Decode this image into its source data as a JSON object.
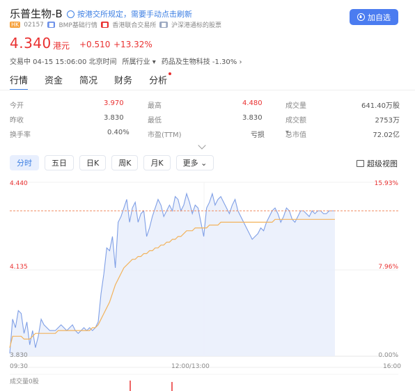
{
  "header": {
    "title": "乐普生物-B",
    "notice": "按港交所规定，需要手动点击刷新",
    "market_tag": "HK",
    "code": "02157",
    "bmp_tag": "BMP基础行情",
    "exchange": "香港联合交易所",
    "connect": "沪深港通标的股票",
    "add_button": "加自选"
  },
  "quote": {
    "price": "4.340",
    "unit": "港元",
    "change": "+0.510",
    "change_pct": "+13.32%",
    "status": "交易中 04-15 15:06:00 北京时间",
    "industry_label": "所属行业",
    "industry": "药品及生物科技 -1.30%"
  },
  "tabs": [
    "行情",
    "资金",
    "简况",
    "财务",
    "分析"
  ],
  "stats": [
    {
      "label": "今开",
      "value": "3.970",
      "color": "#e93030",
      "label2": "最高",
      "value2": "4.480",
      "color2": "#e93030",
      "label3": "成交量",
      "value3": "641.40万股"
    },
    {
      "label": "昨收",
      "value": "3.830",
      "color": "#555",
      "label2": "最低",
      "value2": "3.830",
      "color2": "#555",
      "label3": "成交额",
      "value3": "2753万"
    },
    {
      "label": "换手率",
      "value": "0.40%",
      "color": "#555",
      "label2": "市盈(TTM)",
      "value2": "亏损",
      "color2": "#555",
      "label3": "总市值",
      "value3": "72.02亿"
    }
  ],
  "periods": [
    "分时",
    "五日",
    "日K",
    "周K",
    "月K",
    "更多"
  ],
  "super_view": "超级视图",
  "volume_label": "成交量0股",
  "chart_data": {
    "type": "line",
    "ylim": [
      3.83,
      4.44
    ],
    "yticks_left": [
      "4.440",
      "4.135",
      "3.830"
    ],
    "yticks_right": [
      "15.93%",
      "7.96%",
      "0.00%"
    ],
    "xticks": [
      "09:30",
      "12:00/13:00",
      "16:00"
    ],
    "prev_close": 3.83,
    "reference_line": 4.34,
    "series": [
      {
        "values": [
          3.84,
          3.96,
          3.93,
          3.99,
          3.98,
          3.91,
          3.95,
          3.87,
          3.92,
          3.86,
          3.9,
          3.96,
          3.94,
          3.93,
          3.92,
          3.92,
          3.92,
          3.93,
          3.94,
          3.93,
          3.92,
          3.93,
          3.94,
          3.92,
          3.91,
          3.92,
          3.93,
          3.92,
          3.93,
          3.92,
          3.93,
          3.95,
          4.05,
          4.12,
          4.21,
          4.2,
          4.25,
          4.14,
          4.3,
          4.32,
          4.35,
          4.38,
          4.3,
          4.35,
          4.37,
          4.3,
          4.33,
          4.34,
          4.25,
          4.28,
          4.32,
          4.35,
          4.38,
          4.36,
          4.32,
          4.34,
          4.36,
          4.34,
          4.39,
          4.38,
          4.34,
          4.36,
          4.4,
          4.37,
          4.33,
          4.36,
          4.35,
          4.3,
          4.25,
          4.35,
          4.37,
          4.4,
          4.36,
          4.38,
          4.39,
          4.37,
          4.35,
          4.33,
          4.36,
          4.38,
          4.34,
          4.32,
          4.3,
          4.28,
          4.26,
          4.24,
          4.25,
          4.26,
          4.28,
          4.27,
          4.3,
          4.32,
          4.34,
          4.35,
          4.33,
          4.3,
          4.32,
          4.35,
          4.34,
          4.31,
          4.3,
          4.32,
          4.34,
          4.34,
          4.33,
          4.32,
          4.34,
          4.33,
          4.34,
          4.34,
          4.33,
          4.33,
          4.34,
          4.34,
          4.34
        ]
      },
      {
        "values": [
          3.86,
          3.9,
          3.9,
          3.9,
          3.9,
          3.89,
          3.89,
          3.89,
          3.9,
          3.91,
          3.91,
          3.91,
          3.91,
          3.91,
          3.91,
          3.91,
          3.91,
          3.92,
          3.92,
          3.92,
          3.92,
          3.92,
          3.92,
          3.92,
          3.92,
          3.92,
          3.92,
          3.92,
          3.92,
          3.93,
          3.93,
          3.94,
          3.96,
          3.98,
          4.0,
          4.02,
          4.05,
          4.08,
          4.1,
          4.12,
          4.14,
          4.15,
          4.16,
          4.17,
          4.17,
          4.18,
          4.18,
          4.19,
          4.19,
          4.2,
          4.2,
          4.21,
          4.21,
          4.22,
          4.22,
          4.23,
          4.23,
          4.24,
          4.24,
          4.25,
          4.25,
          4.26,
          4.27,
          4.27,
          4.27,
          4.28,
          4.28,
          4.28,
          4.28,
          4.28,
          4.29,
          4.29,
          4.29,
          4.29,
          4.3,
          4.3,
          4.3,
          4.3,
          4.3,
          4.3,
          4.3,
          4.3,
          4.3,
          4.3,
          4.3,
          4.3,
          4.3,
          4.3,
          4.3,
          4.3,
          4.3,
          4.3,
          4.3,
          4.31,
          4.31,
          4.31,
          4.31,
          4.31,
          4.31,
          4.31,
          4.31,
          4.31,
          4.31,
          4.31,
          4.31,
          4.31,
          4.31,
          4.31,
          4.31,
          4.31,
          4.31,
          4.31,
          4.31,
          4.31,
          4.31
        ]
      }
    ],
    "colors": {
      "price_line": "#7f9fe6",
      "avg_line": "#f2b35c",
      "fill": "#e9eefc",
      "ref_line": "#f08a5d"
    }
  }
}
